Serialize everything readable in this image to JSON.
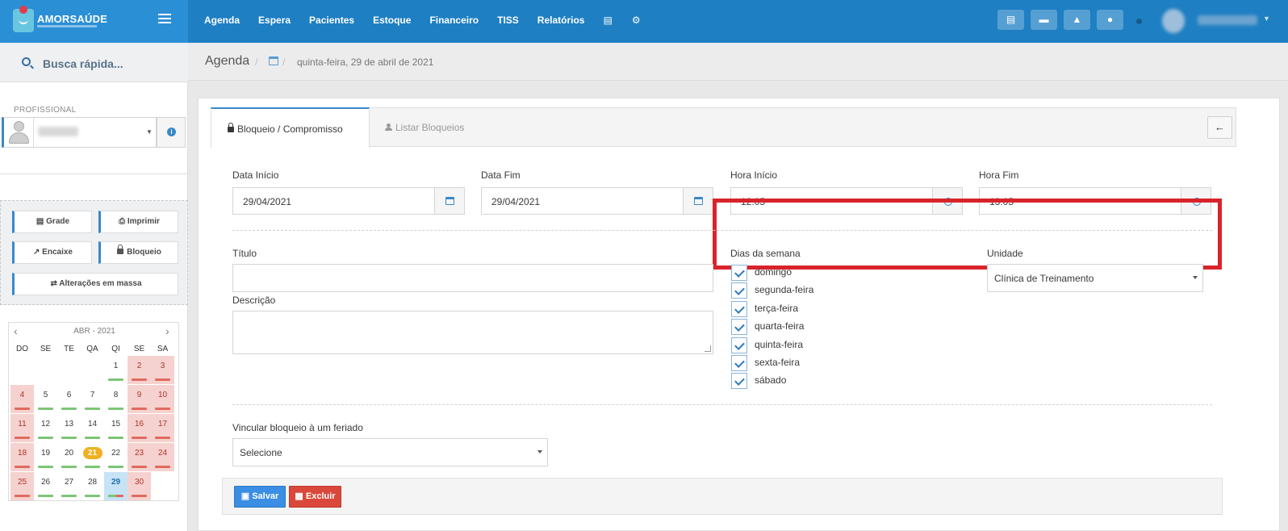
{
  "brand": {
    "name": "AMORSAÚDE"
  },
  "nav": {
    "items": [
      "Agenda",
      "Espera",
      "Pacientes",
      "Estoque",
      "Financeiro",
      "TISS",
      "Relatórios"
    ],
    "icons": [
      "database-icon",
      "gear-icon"
    ]
  },
  "topbar_icons": [
    "inbox-icon",
    "card-icon",
    "bell-icon",
    "chat-icon"
  ],
  "sidebar": {
    "search_placeholder": "Busca rápida...",
    "professional_label": "PROFISSIONAL",
    "buttons": {
      "grade": "Grade",
      "imprimir": "Imprimir",
      "encaixe": "Encaixe",
      "bloqueio": "Bloqueio",
      "alteracoes": "Alterações em massa"
    },
    "calendar": {
      "month_label": "ABR - 2021",
      "weekdays": [
        "DO",
        "SE",
        "TE",
        "QA",
        "QI",
        "SE",
        "SA"
      ],
      "today": 21,
      "selected": 29
    }
  },
  "breadcrumb": {
    "title": "Agenda",
    "date": "quinta-feira, 29 de abril de 2021"
  },
  "tabs": {
    "active": "Bloqueio / Compromisso",
    "inactive": "Listar Bloqueios"
  },
  "form": {
    "data_inicio_label": "Data Início",
    "data_inicio": "29/04/2021",
    "data_fim_label": "Data Fim",
    "data_fim": "29/04/2021",
    "hora_inicio_label": "Hora Início",
    "hora_inicio": "12:05",
    "hora_fim_label": "Hora Fim",
    "hora_fim": "13:05",
    "titulo_label": "Título",
    "descricao_label": "Descrição",
    "dias_label": "Dias da semana",
    "dias": [
      "domingo",
      "segunda-feira",
      "terça-feira",
      "quarta-feira",
      "quinta-feira",
      "sexta-feira",
      "sábado"
    ],
    "unidade_label": "Unidade",
    "unidade_value": "Clínica de Treinamento",
    "feriado_label": "Vincular bloqueio à um feriado",
    "feriado_value": "Selecione"
  },
  "actions": {
    "salvar": "Salvar",
    "excluir": "Excluir"
  },
  "colors": {
    "header": "#1e7fc3",
    "highlight": "#d9232b",
    "save": "#3a8ee3",
    "delete": "#d9483a",
    "weekend_cell": "#f5d2cf"
  }
}
